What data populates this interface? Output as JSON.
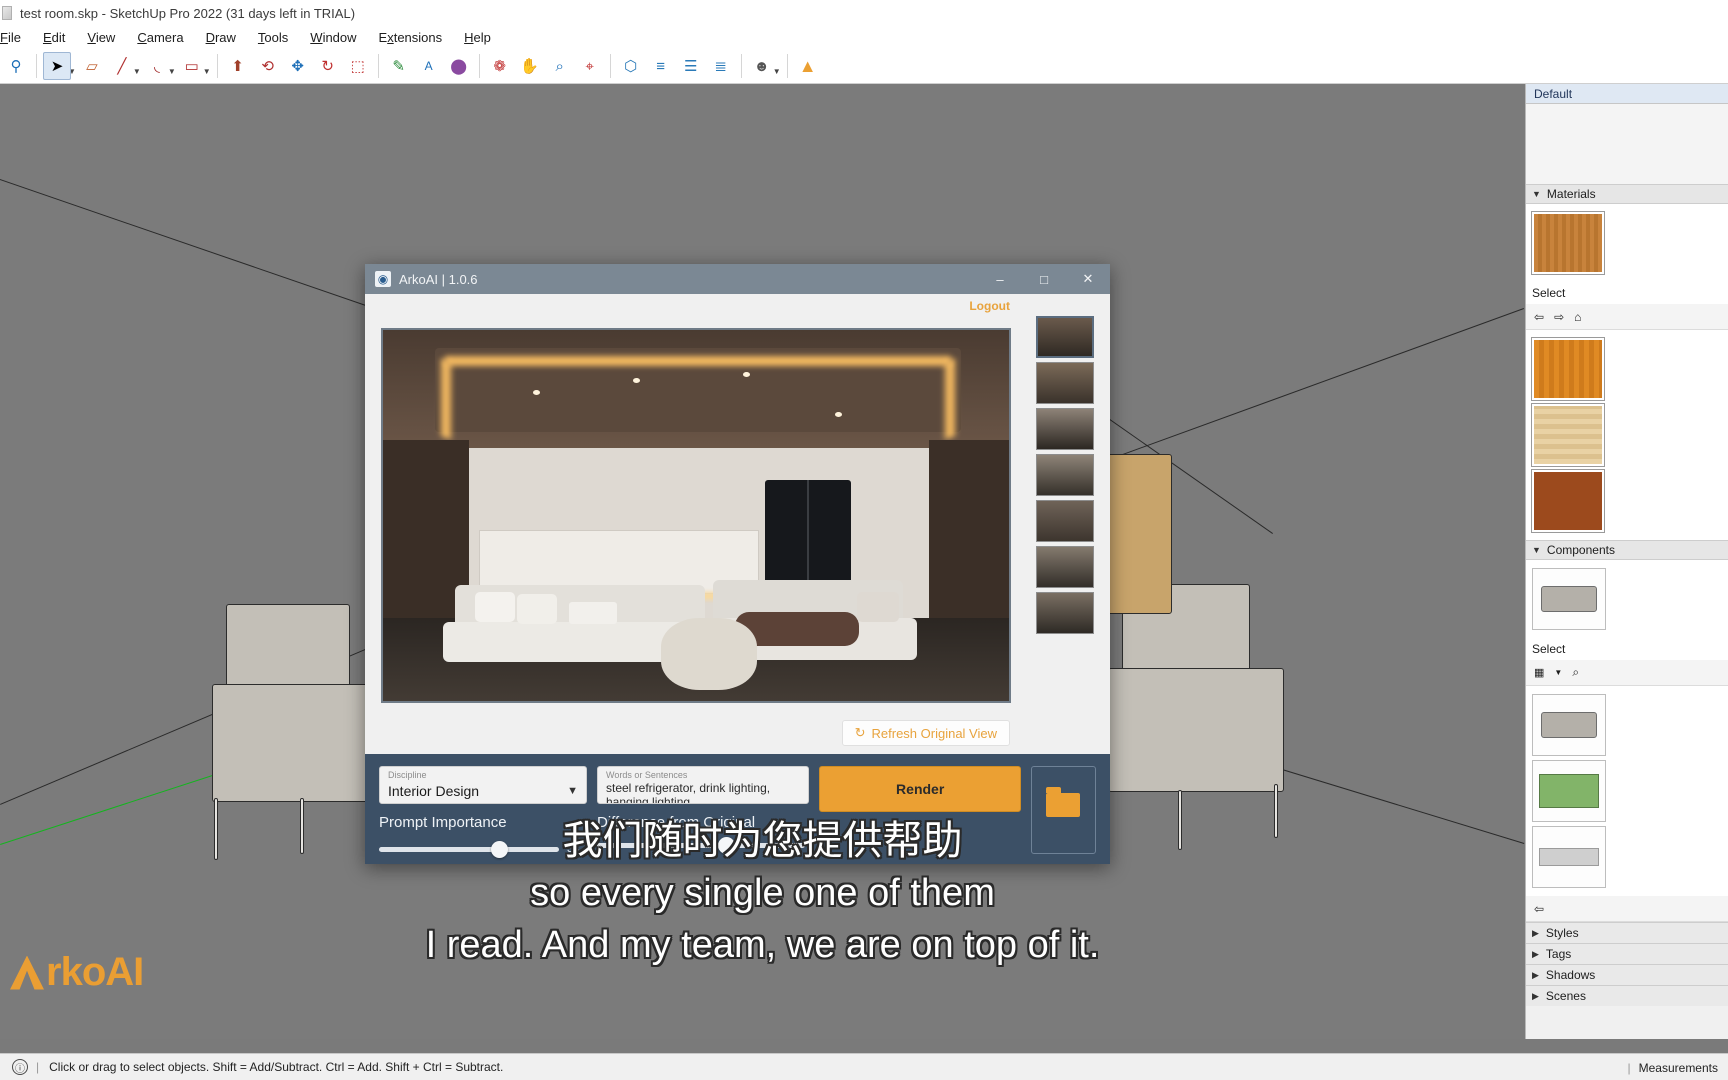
{
  "window": {
    "title": "test room.skp - SketchUp Pro 2022 (31 days left in TRIAL)",
    "app_icon": "sketchup-icon"
  },
  "menu": {
    "items": [
      "File",
      "Edit",
      "View",
      "Camera",
      "Draw",
      "Tools",
      "Window",
      "Extensions",
      "Help"
    ]
  },
  "toolbar": {
    "buttons": [
      {
        "name": "zoom-extents-icon",
        "glyph": "⚲"
      },
      {
        "name": "select-tool-icon",
        "glyph": "➤"
      },
      {
        "name": "eraser-tool-icon",
        "glyph": "▱"
      },
      {
        "name": "line-tool-icon",
        "glyph": "╱"
      },
      {
        "name": "arc-tool-icon",
        "glyph": "◜"
      },
      {
        "name": "rectangle-tool-icon",
        "glyph": "▭"
      },
      {
        "name": "pushpull-tool-icon",
        "glyph": "⬆"
      },
      {
        "name": "followme-tool-icon",
        "glyph": "⟲"
      },
      {
        "name": "move-tool-icon",
        "glyph": "✥"
      },
      {
        "name": "rotate-tool-icon",
        "glyph": "↻"
      },
      {
        "name": "scale-tool-icon",
        "glyph": "⬚"
      },
      {
        "name": "tape-measure-icon",
        "glyph": "✎"
      },
      {
        "name": "text-tool-icon",
        "glyph": "A"
      },
      {
        "name": "paint-bucket-icon",
        "glyph": "⬤"
      },
      {
        "name": "orbit-tool-icon",
        "glyph": "❁"
      },
      {
        "name": "pan-tool-icon",
        "glyph": "✋"
      },
      {
        "name": "zoom-tool-icon",
        "glyph": "⌕"
      },
      {
        "name": "zoom-window-icon",
        "glyph": "⌖"
      },
      {
        "name": "solid-tools-icon",
        "glyph": "⬡"
      },
      {
        "name": "section-plane-icon",
        "glyph": "≡"
      },
      {
        "name": "layers-icon",
        "glyph": "☰"
      },
      {
        "name": "styles-icon",
        "glyph": "≣"
      },
      {
        "name": "account-icon",
        "glyph": "●"
      },
      {
        "name": "arko-extension-icon",
        "glyph": "▲"
      }
    ]
  },
  "dialog": {
    "title": "ArkoAI | 1.0.6",
    "icon": "arko-logo-icon",
    "minimize_label": "–",
    "maximize_label": "□",
    "close_label": "✕",
    "logout_label": "Logout",
    "refresh_button": {
      "label": "Refresh Original View",
      "icon": "refresh-icon"
    },
    "thumbnails": [
      {
        "name": "thumbnail-1"
      },
      {
        "name": "thumbnail-2"
      },
      {
        "name": "thumbnail-3"
      },
      {
        "name": "thumbnail-4"
      },
      {
        "name": "thumbnail-5"
      },
      {
        "name": "thumbnail-6"
      },
      {
        "name": "thumbnail-7"
      }
    ],
    "controls": {
      "discipline_label": "Discipline",
      "discipline_value": "Interior Design",
      "words_label": "Words or Sentences",
      "words_value": "steel refrigerator, drink lighting, hanging lighting",
      "prompt_importance_label": "Prompt Importance",
      "prompt_importance_value": "34",
      "difference_label": "Difference from Original",
      "render_label": "Render",
      "upload_icon": "folder-upload-icon"
    },
    "accent_color": "#eba033",
    "panel_color": "#3c5066"
  },
  "tray": {
    "active_tab": "Default",
    "sections": [
      {
        "title": "Materials",
        "expanded": true
      },
      {
        "title": "Components",
        "expanded": true
      },
      {
        "title": "Styles",
        "expanded": false
      },
      {
        "title": "Tags",
        "expanded": false
      },
      {
        "title": "Shadows",
        "expanded": false
      },
      {
        "title": "Scenes",
        "expanded": false
      }
    ],
    "select_label": "Select",
    "materials_swatches": [
      "wood-swatch-1",
      "wood-swatch-2",
      "wood-swatch-3",
      "wood-swatch-4"
    ],
    "component_thumbs": [
      "sofa-component",
      "plan-component",
      "gray-component"
    ]
  },
  "statusbar": {
    "info_icon": "info-icon",
    "hint": "Click or drag to select objects. Shift = Add/Subtract. Ctrl = Add. Shift + Ctrl = Subtract.",
    "measurements_label": "Measurements"
  },
  "watermark": {
    "text": "rkoAI",
    "logo": "arko-triangle-logo"
  },
  "subtitles": {
    "lines": [
      "我们随时为您提供帮助",
      "so every single one of them",
      "I read. And my team, we are on top of it."
    ]
  }
}
